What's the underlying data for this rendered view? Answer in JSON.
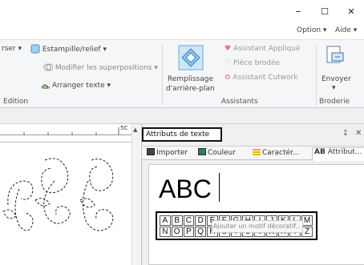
{
  "window": {
    "minimize": "–",
    "maximize": "☐",
    "close": "✕"
  },
  "menubar": {
    "option": "Option",
    "aide": "Aide"
  },
  "ribbon": {
    "edition": {
      "cut_text": "rser",
      "stamp": "Estampille/relief",
      "modify_overlap": "Modifier les superpositions",
      "arrange_text": "Arranger texte",
      "label": "Edition"
    },
    "assistants": {
      "fill_bg_line1": "Remplissage",
      "fill_bg_line2": "d'arrière-plan",
      "applique": "Assistant Appliqué",
      "piece": "Pièce brodée",
      "cutwork": "Assistant Cutwork",
      "label": "Assistants"
    },
    "broderie": {
      "send": "Envoyer",
      "label": "Broderie"
    }
  },
  "ruler": {
    "mark": "5C"
  },
  "panel": {
    "title": "Attributs de texte",
    "pin": "↧",
    "close": "✕",
    "tabs": [
      "Importer",
      "Couleur",
      "Caractér...",
      "Attribut..."
    ],
    "preview_text": "ABC",
    "row1": [
      "A",
      "B",
      "C",
      "D",
      "E",
      "F",
      "G",
      "H",
      "I",
      "J",
      "K",
      "L",
      "M"
    ],
    "row2": [
      "N",
      "O",
      "P",
      "Q",
      "R",
      "S",
      "T",
      "U",
      "V",
      "W",
      "X",
      "Y",
      "Z"
    ],
    "add_motif": "Ajouter un motif décoratif..."
  }
}
